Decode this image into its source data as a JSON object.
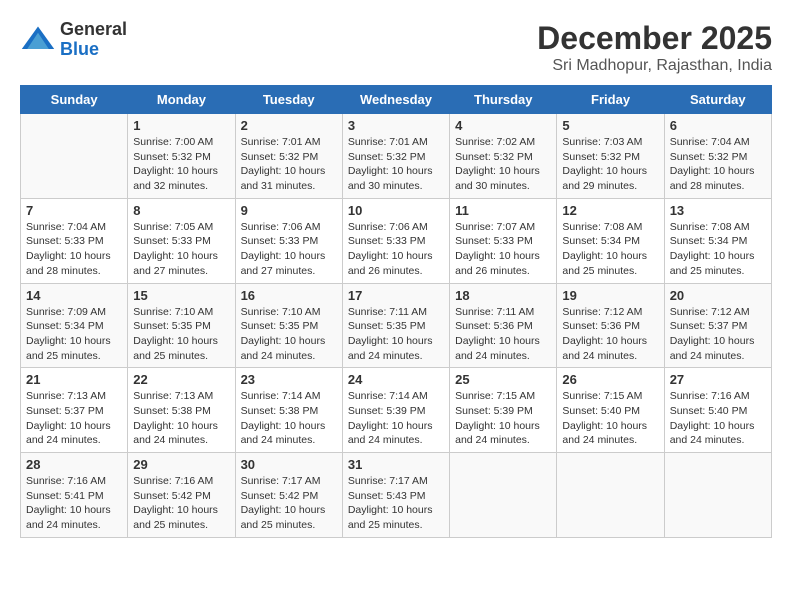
{
  "logo": {
    "general": "General",
    "blue": "Blue"
  },
  "title": {
    "month": "December 2025",
    "location": "Sri Madhopur, Rajasthan, India"
  },
  "weekdays": [
    "Sunday",
    "Monday",
    "Tuesday",
    "Wednesday",
    "Thursday",
    "Friday",
    "Saturday"
  ],
  "weeks": [
    [
      {
        "day": "",
        "info": ""
      },
      {
        "day": "1",
        "info": "Sunrise: 7:00 AM\nSunset: 5:32 PM\nDaylight: 10 hours\nand 32 minutes."
      },
      {
        "day": "2",
        "info": "Sunrise: 7:01 AM\nSunset: 5:32 PM\nDaylight: 10 hours\nand 31 minutes."
      },
      {
        "day": "3",
        "info": "Sunrise: 7:01 AM\nSunset: 5:32 PM\nDaylight: 10 hours\nand 30 minutes."
      },
      {
        "day": "4",
        "info": "Sunrise: 7:02 AM\nSunset: 5:32 PM\nDaylight: 10 hours\nand 30 minutes."
      },
      {
        "day": "5",
        "info": "Sunrise: 7:03 AM\nSunset: 5:32 PM\nDaylight: 10 hours\nand 29 minutes."
      },
      {
        "day": "6",
        "info": "Sunrise: 7:04 AM\nSunset: 5:32 PM\nDaylight: 10 hours\nand 28 minutes."
      }
    ],
    [
      {
        "day": "7",
        "info": "Sunrise: 7:04 AM\nSunset: 5:33 PM\nDaylight: 10 hours\nand 28 minutes."
      },
      {
        "day": "8",
        "info": "Sunrise: 7:05 AM\nSunset: 5:33 PM\nDaylight: 10 hours\nand 27 minutes."
      },
      {
        "day": "9",
        "info": "Sunrise: 7:06 AM\nSunset: 5:33 PM\nDaylight: 10 hours\nand 27 minutes."
      },
      {
        "day": "10",
        "info": "Sunrise: 7:06 AM\nSunset: 5:33 PM\nDaylight: 10 hours\nand 26 minutes."
      },
      {
        "day": "11",
        "info": "Sunrise: 7:07 AM\nSunset: 5:33 PM\nDaylight: 10 hours\nand 26 minutes."
      },
      {
        "day": "12",
        "info": "Sunrise: 7:08 AM\nSunset: 5:34 PM\nDaylight: 10 hours\nand 25 minutes."
      },
      {
        "day": "13",
        "info": "Sunrise: 7:08 AM\nSunset: 5:34 PM\nDaylight: 10 hours\nand 25 minutes."
      }
    ],
    [
      {
        "day": "14",
        "info": "Sunrise: 7:09 AM\nSunset: 5:34 PM\nDaylight: 10 hours\nand 25 minutes."
      },
      {
        "day": "15",
        "info": "Sunrise: 7:10 AM\nSunset: 5:35 PM\nDaylight: 10 hours\nand 25 minutes."
      },
      {
        "day": "16",
        "info": "Sunrise: 7:10 AM\nSunset: 5:35 PM\nDaylight: 10 hours\nand 24 minutes."
      },
      {
        "day": "17",
        "info": "Sunrise: 7:11 AM\nSunset: 5:35 PM\nDaylight: 10 hours\nand 24 minutes."
      },
      {
        "day": "18",
        "info": "Sunrise: 7:11 AM\nSunset: 5:36 PM\nDaylight: 10 hours\nand 24 minutes."
      },
      {
        "day": "19",
        "info": "Sunrise: 7:12 AM\nSunset: 5:36 PM\nDaylight: 10 hours\nand 24 minutes."
      },
      {
        "day": "20",
        "info": "Sunrise: 7:12 AM\nSunset: 5:37 PM\nDaylight: 10 hours\nand 24 minutes."
      }
    ],
    [
      {
        "day": "21",
        "info": "Sunrise: 7:13 AM\nSunset: 5:37 PM\nDaylight: 10 hours\nand 24 minutes."
      },
      {
        "day": "22",
        "info": "Sunrise: 7:13 AM\nSunset: 5:38 PM\nDaylight: 10 hours\nand 24 minutes."
      },
      {
        "day": "23",
        "info": "Sunrise: 7:14 AM\nSunset: 5:38 PM\nDaylight: 10 hours\nand 24 minutes."
      },
      {
        "day": "24",
        "info": "Sunrise: 7:14 AM\nSunset: 5:39 PM\nDaylight: 10 hours\nand 24 minutes."
      },
      {
        "day": "25",
        "info": "Sunrise: 7:15 AM\nSunset: 5:39 PM\nDaylight: 10 hours\nand 24 minutes."
      },
      {
        "day": "26",
        "info": "Sunrise: 7:15 AM\nSunset: 5:40 PM\nDaylight: 10 hours\nand 24 minutes."
      },
      {
        "day": "27",
        "info": "Sunrise: 7:16 AM\nSunset: 5:40 PM\nDaylight: 10 hours\nand 24 minutes."
      }
    ],
    [
      {
        "day": "28",
        "info": "Sunrise: 7:16 AM\nSunset: 5:41 PM\nDaylight: 10 hours\nand 24 minutes."
      },
      {
        "day": "29",
        "info": "Sunrise: 7:16 AM\nSunset: 5:42 PM\nDaylight: 10 hours\nand 25 minutes."
      },
      {
        "day": "30",
        "info": "Sunrise: 7:17 AM\nSunset: 5:42 PM\nDaylight: 10 hours\nand 25 minutes."
      },
      {
        "day": "31",
        "info": "Sunrise: 7:17 AM\nSunset: 5:43 PM\nDaylight: 10 hours\nand 25 minutes."
      },
      {
        "day": "",
        "info": ""
      },
      {
        "day": "",
        "info": ""
      },
      {
        "day": "",
        "info": ""
      }
    ]
  ]
}
